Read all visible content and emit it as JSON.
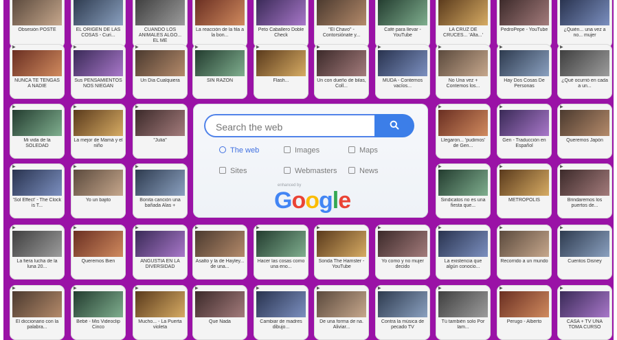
{
  "search": {
    "placeholder": "Search the web",
    "options": [
      {
        "label": "The web",
        "icon": "search-icon"
      },
      {
        "label": "Images",
        "icon": "image-icon"
      },
      {
        "label": "Maps",
        "icon": "map-icon"
      },
      {
        "label": "Sites",
        "icon": "checkbox-icon"
      },
      {
        "label": "Webmasters",
        "icon": "grid-icon"
      },
      {
        "label": "News",
        "icon": "news-icon"
      }
    ],
    "powered_by": "enhanced by",
    "logo_text": "Google"
  },
  "tiles": [
    {
      "caption": "Obsesión POSTE"
    },
    {
      "caption": "EL ORIGEN DE LAS COSAS - Curi..."
    },
    {
      "caption": "CUANDO LOS ANIMALES ALGO... EL ME"
    },
    {
      "caption": "La reacción de la fila a la bon..."
    },
    {
      "caption": "Peto Caballero Doble Check"
    },
    {
      "caption": "\"El Chavo\" - Contorsiónate y..."
    },
    {
      "caption": "Café para llevar - YouTube"
    },
    {
      "caption": "LA CRUZ DE CRUCES... 'Alta...'"
    },
    {
      "caption": "PedroPepe - YouTube"
    },
    {
      "caption": "¿Quién... una vez a no... mujer"
    },
    {
      "caption": "NUNCA TE TENGAS A NADIE"
    },
    {
      "caption": "Sus PENSAMIENTOS NOS NIEGAN"
    },
    {
      "caption": "Un Día Cualquiera"
    },
    {
      "caption": "SIN RAZÓN"
    },
    {
      "caption": "Flash..."
    },
    {
      "caption": "Un con dueño de bilas, Coll..."
    },
    {
      "caption": "MUDA - Contemos vacíos..."
    },
    {
      "caption": "No Una vez + Contemos los..."
    },
    {
      "caption": "Hay Dos Cosas De Personas"
    },
    {
      "caption": "¿Qué ocurrió en cada a un..."
    },
    {
      "caption": "Mi vida de la SOLEDAD"
    },
    {
      "caption": "La mejor de Mamá y el niño"
    },
    {
      "caption": "\"Julia\""
    },
    {
      "caption": "Llegaron... 'pudimos' de Gen..."
    },
    {
      "caption": "Gen - Traducción en Español"
    },
    {
      "caption": "Queremos Japón"
    },
    {
      "caption": "'Sol Effect' - The Clock is T..."
    },
    {
      "caption": "Yo un bajito"
    },
    {
      "caption": "Bonita canción una bañada Alas +"
    },
    {
      "caption": "Sindicatos no es una fiesta que..."
    },
    {
      "caption": "METRÓPOLIS"
    },
    {
      "caption": "Brindaremos los puertos de..."
    },
    {
      "caption": "La fiera lucha de la luna 20..."
    },
    {
      "caption": "Queremos Bien"
    },
    {
      "caption": "ANGUSTIA EN LA DIVERSIDAD"
    },
    {
      "caption": "Asalto y la de Hayley... de una..."
    },
    {
      "caption": "Hacer las cosas como una eno..."
    },
    {
      "caption": "Sonda The Hamster - YouTube"
    },
    {
      "caption": "Yo como y no mujer decido"
    },
    {
      "caption": "La existencia que algún conocio..."
    },
    {
      "caption": "Recorrido a un mundo"
    },
    {
      "caption": "Cuentos Disney"
    },
    {
      "caption": "El diccionario con la palabra..."
    },
    {
      "caption": "Bebé - Mis Videoclip Cinco"
    },
    {
      "caption": "Mucho... - La Puerta violeta"
    },
    {
      "caption": "Que Nada"
    },
    {
      "caption": "Cambiar de madres dibujo..."
    },
    {
      "caption": "De una forma de na. Aliviar..."
    },
    {
      "caption": "Contra la música de pecado TV"
    },
    {
      "caption": "Tú también solo Por Iam..."
    },
    {
      "caption": "Perugo - Alberto"
    },
    {
      "caption": "CASA + TV UNA TOMA CURSO"
    }
  ]
}
